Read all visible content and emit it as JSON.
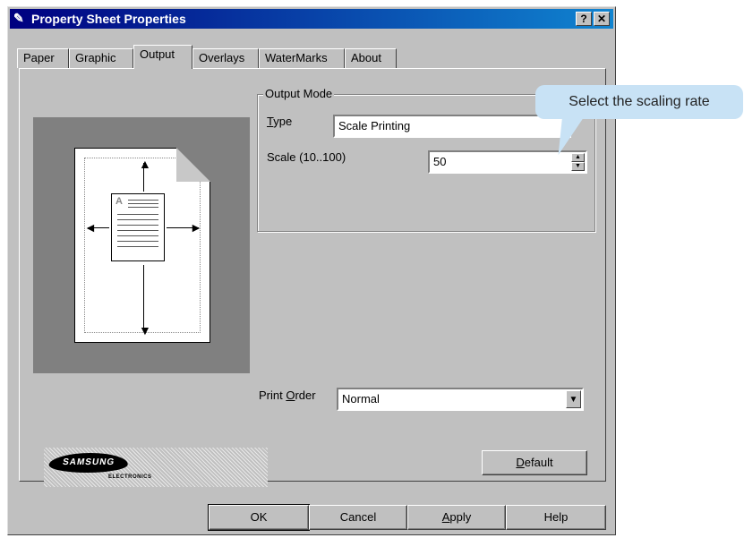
{
  "window": {
    "title": "Property Sheet Properties",
    "help_label": "?",
    "close_label": "✕"
  },
  "tabs": [
    "Paper",
    "Graphic",
    "Output",
    "Overlays",
    "WaterMarks",
    "About"
  ],
  "active_tab": "Output",
  "output_mode": {
    "group_title": "Output Mode",
    "type_label_u": "T",
    "type_label_rest": "ype",
    "type_value": "Scale Printing",
    "scale_label": "Scale (10..100)",
    "scale_value": "50"
  },
  "print_order": {
    "label_pre": "Print ",
    "label_u": "O",
    "label_post": "rder",
    "value": "Normal"
  },
  "buttons": {
    "default_u": "D",
    "default_rest": "efault",
    "ok": "OK",
    "cancel": "Cancel",
    "apply_u": "A",
    "apply_rest": "pply",
    "help": "Help"
  },
  "logo": {
    "brand": "SAMSUNG",
    "sub": "ELECTRONICS"
  },
  "callout": {
    "text": "Select the scaling rate"
  },
  "preview": {
    "glyph": "A"
  }
}
